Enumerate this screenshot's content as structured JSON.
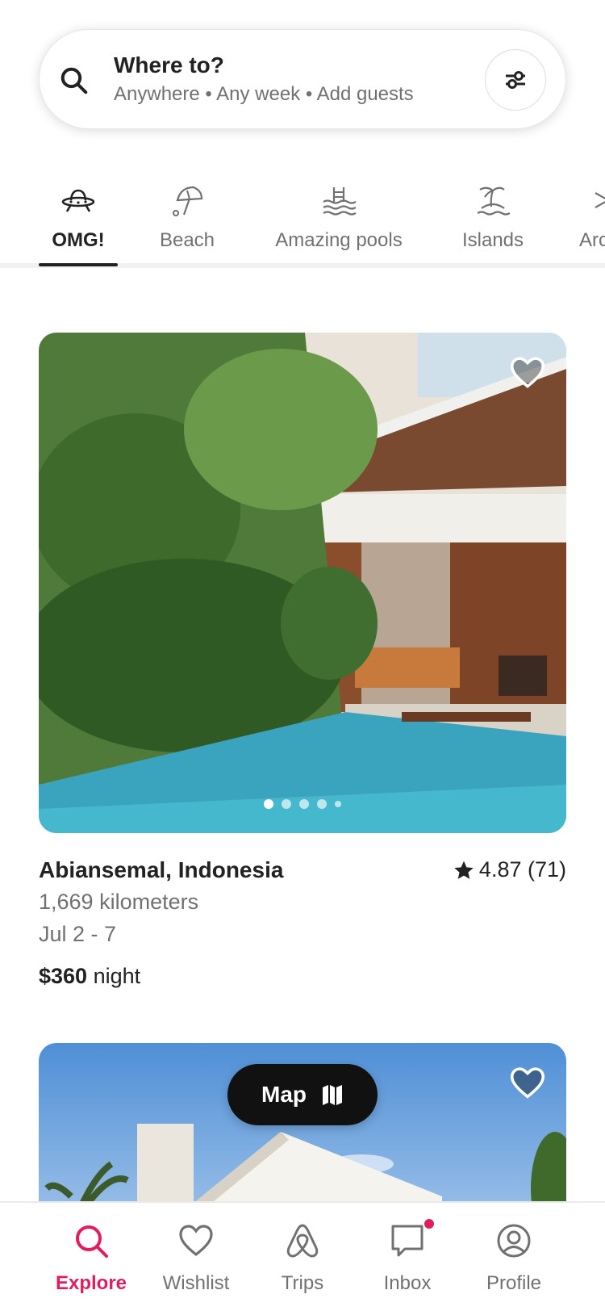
{
  "search": {
    "title": "Where to?",
    "subtitle": "Anywhere • Any week • Add guests",
    "search_icon": "search-icon",
    "filter_icon": "filter-sliders-icon"
  },
  "categories": [
    {
      "label": "OMG!",
      "icon": "ufo-icon",
      "active": true
    },
    {
      "label": "Beach",
      "icon": "beach-umbrella-icon",
      "active": false
    },
    {
      "label": "Amazing pools",
      "icon": "pool-icon",
      "active": false
    },
    {
      "label": "Islands",
      "icon": "island-icon",
      "active": false
    },
    {
      "label": "Arc",
      "icon": "arctic-icon",
      "active": false
    }
  ],
  "listing": {
    "location": "Abiansemal, Indonesia",
    "rating": "4.87 (71)",
    "distance": "1,669 kilometers",
    "dates": "Jul 2 - 7",
    "price": "$360",
    "price_unit": "night",
    "photo_count": 5,
    "active_photo": 1
  },
  "map_button": {
    "label": "Map",
    "icon": "map-icon"
  },
  "nav": [
    {
      "label": "Explore",
      "icon": "search-icon",
      "active": true
    },
    {
      "label": "Wishlist",
      "icon": "heart-icon",
      "active": false
    },
    {
      "label": "Trips",
      "icon": "airbnb-logo-icon",
      "active": false
    },
    {
      "label": "Inbox",
      "icon": "message-icon",
      "active": false,
      "badge": true
    },
    {
      "label": "Profile",
      "icon": "profile-icon",
      "active": false
    }
  ],
  "colors": {
    "accent": "#e31c5f",
    "text": "#222222",
    "muted": "#717171"
  }
}
